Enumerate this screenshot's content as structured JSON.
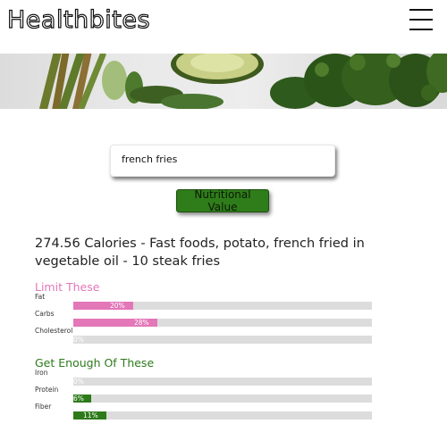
{
  "header": {
    "logo": "Healthbites",
    "menu_icon": "hamburger-icon"
  },
  "search": {
    "value": "french fries"
  },
  "button": {
    "label": "Nutritional Value"
  },
  "result": {
    "title": "274.56 Calories - Fast foods, potato, french fried in vegetable oil - 10 steak fries"
  },
  "limit": {
    "title": "Limit These",
    "color": "#e377b8",
    "items": [
      {
        "label": "Fat",
        "percent": 20,
        "display": "20%"
      },
      {
        "label": "Carbs",
        "percent": 28,
        "display": "28%"
      },
      {
        "label": "Cholesterol",
        "percent": 0,
        "display": "0%"
      }
    ]
  },
  "enough": {
    "title": "Get Enough Of These",
    "color": "#2d7a1a",
    "items": [
      {
        "label": "Iron",
        "percent": 0,
        "display": "0%"
      },
      {
        "label": "Protein",
        "percent": 6,
        "display": "6%"
      },
      {
        "label": "Fiber",
        "percent": 11,
        "display": "11%"
      }
    ]
  }
}
